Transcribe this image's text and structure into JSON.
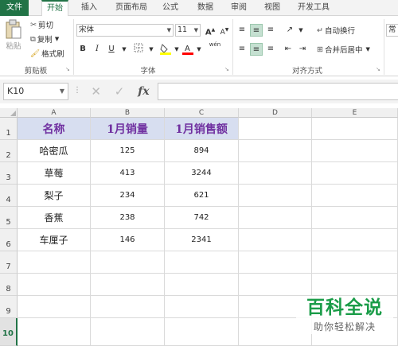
{
  "ribbon": {
    "tabs": [
      "文件",
      "开始",
      "插入",
      "页面布局",
      "公式",
      "数据",
      "审阅",
      "视图",
      "开发工具"
    ],
    "active_tab": "开始",
    "clipboard": {
      "paste": "粘贴",
      "cut": "剪切",
      "copy": "复制",
      "format_painter": "格式刷",
      "label": "剪贴板"
    },
    "font": {
      "name": "宋体",
      "size": "11",
      "grow": "A",
      "shrink": "A",
      "bold": "B",
      "italic": "I",
      "underline": "U",
      "label": "字体",
      "phonetic": "wén"
    },
    "alignment": {
      "wrap_text": "自动换行",
      "merge_center": "合并后居中",
      "label": "对齐方式"
    },
    "number_format_partial": "常规",
    "colors": {
      "accent": "#217346",
      "font_color_bar": "#ff0000",
      "fill_color_bar": "#ffff00"
    }
  },
  "formula_bar": {
    "name_box": "K10",
    "cancel_icon": "✕",
    "enter_icon": "✓",
    "fx": "fx",
    "formula": ""
  },
  "sheet": {
    "columns": [
      "A",
      "B",
      "C",
      "D",
      "E"
    ],
    "rows": [
      "1",
      "2",
      "3",
      "4",
      "5",
      "6",
      "7",
      "8",
      "9",
      "10"
    ],
    "selected_row": "10",
    "header": [
      "名称",
      "1月销量",
      "1月销售额"
    ],
    "data": [
      [
        "哈密瓜",
        "125",
        "894"
      ],
      [
        "草莓",
        "413",
        "3244"
      ],
      [
        "梨子",
        "234",
        "621"
      ],
      [
        "香蕉",
        "238",
        "742"
      ],
      [
        "车厘子",
        "146",
        "2341"
      ]
    ],
    "header_fill": "#d7def0",
    "header_text_color": "#7030a0"
  },
  "watermark": {
    "title": "百科全说",
    "subtitle": "助你轻松解决"
  }
}
